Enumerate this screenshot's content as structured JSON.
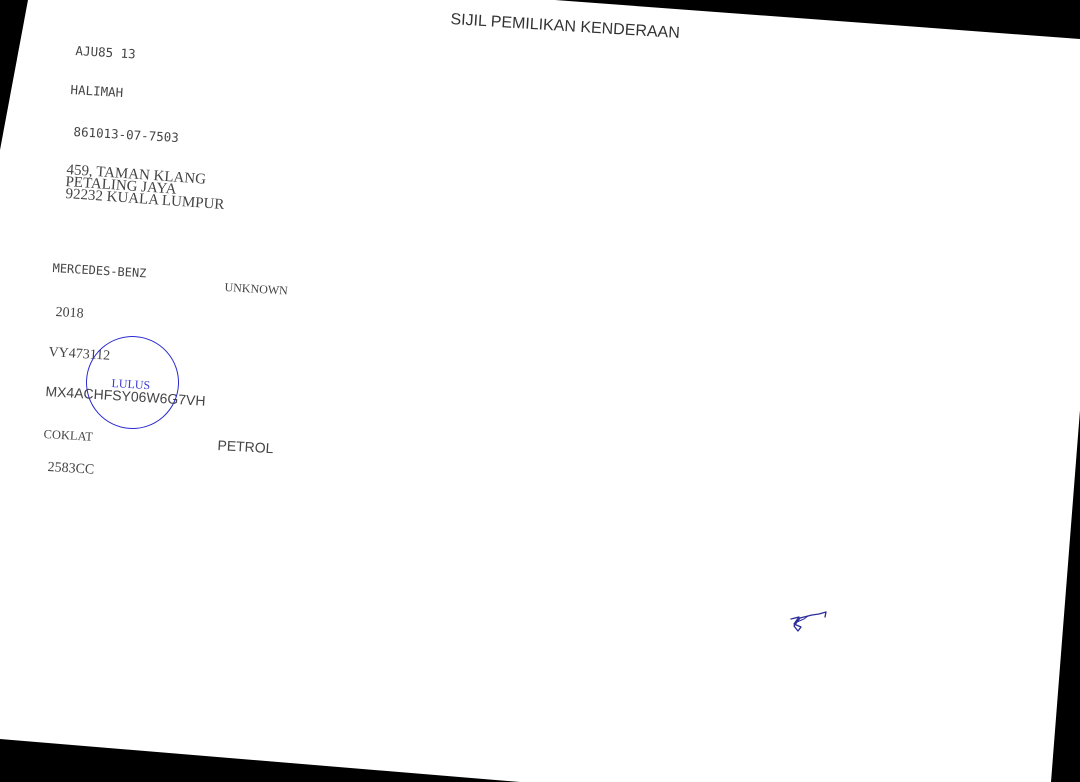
{
  "document": {
    "title": "SIJIL PEMILIKAN KENDERAAN",
    "registration_no": "AJU85 13",
    "owner_name": "HALIMAH",
    "ic_no": "861013-07-7503",
    "address": {
      "line1": "459, TAMAN KLANG",
      "line2": "PETALING JAYA",
      "line3": "92232 KUALA LUMPUR"
    },
    "vehicle": {
      "make": "MERCEDES-BENZ",
      "model": "UNKNOWN",
      "year": "2018",
      "engine_no": "VY473112",
      "chassis_no": "MX4ACHFSY06W6G7VH",
      "color": "COKLAT",
      "fuel": "PETROL",
      "capacity": "2583CC"
    },
    "stamp": {
      "text": "LULUS",
      "color": "#2b2bd0"
    },
    "signature": {
      "color": "#2a2a9a"
    }
  }
}
